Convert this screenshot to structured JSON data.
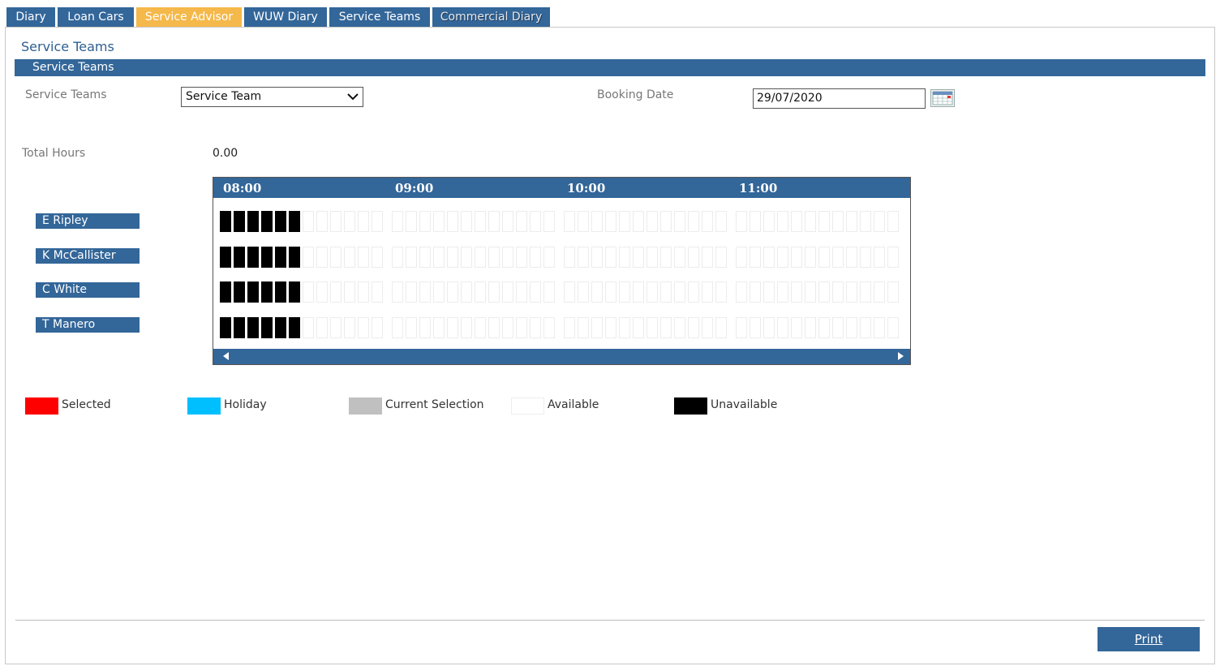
{
  "tabs": [
    {
      "label": "Diary",
      "active": false
    },
    {
      "label": "Loan Cars",
      "active": false
    },
    {
      "label": "Service Advisor",
      "active": true
    },
    {
      "label": "WUW Diary",
      "active": false
    },
    {
      "label": "Service Teams",
      "active": false
    },
    {
      "label": "Commercial Diary",
      "active": false
    }
  ],
  "page": {
    "title": "Service Teams",
    "section_title": "Service Teams"
  },
  "form": {
    "team_label": "Service Teams",
    "team_selected": "Service Team",
    "booking_date_label": "Booking Date",
    "booking_date_value": "29/07/2020",
    "total_hours_label": "Total Hours",
    "total_hours_value": "0.00"
  },
  "schedule": {
    "hours": [
      "08:00",
      "09:00",
      "10:00",
      "11:00"
    ],
    "slots_per_hour": 12,
    "technicians": [
      {
        "name": "E Ripley",
        "unavailable_slots": 6
      },
      {
        "name": "K McCallister",
        "unavailable_slots": 6
      },
      {
        "name": "C White",
        "unavailable_slots": 6
      },
      {
        "name": "T Manero",
        "unavailable_slots": 6
      }
    ]
  },
  "legend": [
    {
      "label": "Selected",
      "color": "#ff0000"
    },
    {
      "label": "Holiday",
      "color": "#00bfff"
    },
    {
      "label": "Current Selection",
      "color": "#c0c0c0"
    },
    {
      "label": "Available",
      "color": "#ffffff"
    },
    {
      "label": "Unavailable",
      "color": "#000000"
    }
  ],
  "actions": {
    "print_label": "Print"
  },
  "colors": {
    "primary": "#336699",
    "active_tab": "#f5b84a"
  }
}
